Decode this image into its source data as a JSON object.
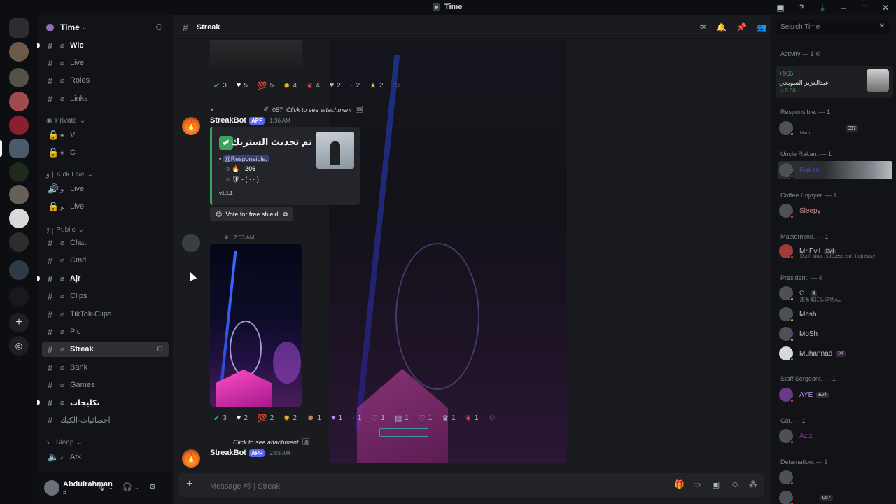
{
  "window": {
    "title": "Time"
  },
  "guild": {
    "name": "Time"
  },
  "channels": [
    {
      "label": "Wlc"
    },
    {
      "label": "Live"
    },
    {
      "label": "Roles"
    },
    {
      "label": "Links"
    },
    {
      "label": "V"
    },
    {
      "label": "C"
    },
    {
      "label": "Live"
    },
    {
      "label": "Live"
    },
    {
      "label": "Chat"
    },
    {
      "label": "Cmd"
    },
    {
      "label": "Ajr"
    },
    {
      "label": "Clips"
    },
    {
      "label": "TikTok-Clips"
    },
    {
      "label": "Pic"
    },
    {
      "label": "Streak"
    },
    {
      "label": "Bank"
    },
    {
      "label": "Games"
    },
    {
      "label": "تكليجات"
    },
    {
      "label": "احصائيات-الكبك"
    },
    {
      "label": "Afk"
    }
  ],
  "categories": [
    "Private",
    "Kick Live",
    "Public",
    "Sleep"
  ],
  "category_prefix": [
    "",
    "ﻮ |",
    "ｸ |",
    "ﺫ |"
  ],
  "user": {
    "name": "Abdulrahman"
  },
  "chat": {
    "channel_name": "Streak",
    "reactions_1": [
      "3",
      "5",
      "5",
      "4",
      "4",
      "2",
      "2",
      "2"
    ],
    "reply_1": {
      "tag": "057",
      "text": "Click to see attachment"
    },
    "bot_name": "StreakBot",
    "app_badge": "APP",
    "time_1": "1:36 AM",
    "embed": {
      "title": "تم تحديث الستريك •",
      "mention": "@Responsible.",
      "streak": "206",
      "shield": "- (  ·  ·  )",
      "footer": "v1.1.1"
    },
    "vote_button": "Vote for free shield!",
    "time_2": "2:03 AM",
    "reactions_2": [
      "3",
      "2",
      "2",
      "2",
      "1",
      "1",
      "1",
      "1",
      "1",
      "1",
      "1",
      "1"
    ],
    "reply_2": {
      "text": "Click to see attachment"
    },
    "time_3": "2:03 AM",
    "composer_placeholder": "Message #ｸ | Streak"
  },
  "members": {
    "search_placeholder": "Search Time",
    "activity_header": "Activity — 1",
    "activity": {
      "line1": "+965",
      "line2": "عبدالعزيز السويجي",
      "line3": "0:56"
    },
    "groups": [
      {
        "title": "Responsible. — 1"
      },
      {
        "title": "Uncle Rakan. — 1"
      },
      {
        "title": "Coffee Enjoyer. — 1"
      },
      {
        "title": "Mastermind. — 1"
      },
      {
        "title": "President. — 4"
      },
      {
        "title": "Staff Sergeant. — 1"
      },
      {
        "title": "Cat. — 1"
      },
      {
        "title": "Defamation. — 3"
      }
    ],
    "list": [
      {
        "name": "",
        "sub": "Nvm",
        "tag": "057"
      },
      {
        "name": "Rakan"
      },
      {
        "name": "Sleepy"
      },
      {
        "name": "Mr.Evil",
        "sub": "Don't stop , success isn't that easy",
        "tag": "Evil"
      },
      {
        "name": "ଘ.",
        "sub": "誰も気にしません。",
        "tag": "4"
      },
      {
        "name": "Mesh"
      },
      {
        "name": "MoSh"
      },
      {
        "name": "Muhannad",
        "tag": "94"
      },
      {
        "name": "AYE",
        "tag": "Evil"
      },
      {
        "name": "Aziz"
      },
      {
        "name": ""
      },
      {
        "name": "",
        "tag": "057"
      }
    ]
  },
  "colors": {
    "green": "#3ba55c",
    "blurple": "#5865f2",
    "bg": "#1a1b1f"
  }
}
